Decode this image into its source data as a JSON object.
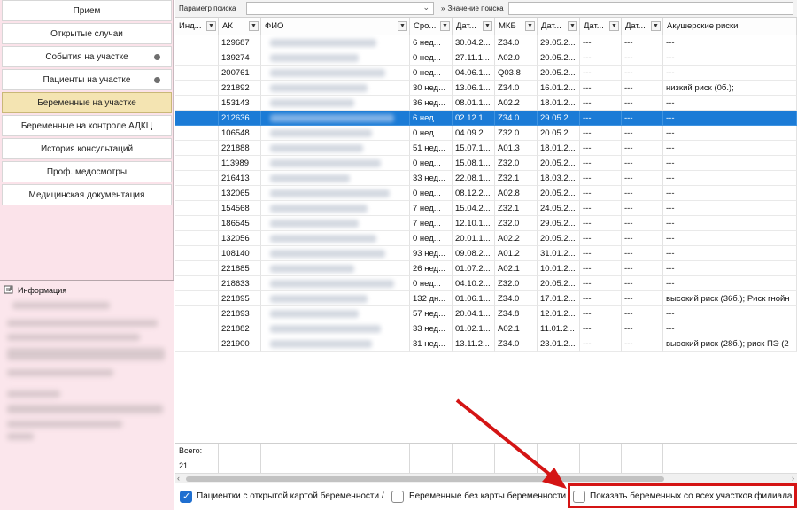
{
  "nav": {
    "items": [
      {
        "label": "Прием",
        "active": false,
        "dot": false
      },
      {
        "label": "Открытые случаи",
        "active": false,
        "dot": false
      },
      {
        "label": "События на участке",
        "active": false,
        "dot": true
      },
      {
        "label": "Пациенты на участке",
        "active": false,
        "dot": true
      },
      {
        "label": "Беременные на участке",
        "active": true,
        "dot": false
      },
      {
        "label": "Беременные на контроле АДКЦ",
        "active": false,
        "dot": false
      },
      {
        "label": "История консультаций",
        "active": false,
        "dot": false
      },
      {
        "label": "Проф. медосмотры",
        "active": false,
        "dot": false
      },
      {
        "label": "Медицинская документация",
        "active": false,
        "dot": false
      }
    ]
  },
  "info": {
    "title": "Информация"
  },
  "search": {
    "param_label": "Параметр поиска",
    "param_value": "",
    "value_label": "Значение поиска",
    "value": ""
  },
  "grid": {
    "columns": [
      {
        "label": "Инд...",
        "filter": true
      },
      {
        "label": "АК",
        "filter": true
      },
      {
        "label": "ФИО",
        "filter": true
      },
      {
        "label": "Сро...",
        "filter": true
      },
      {
        "label": "Дат...",
        "filter": true
      },
      {
        "label": "МКБ",
        "filter": true
      },
      {
        "label": "Дат...",
        "filter": true
      },
      {
        "label": "Дат...",
        "filter": true
      },
      {
        "label": "Дат...",
        "filter": true
      },
      {
        "label": "Акушерские риски",
        "filter": false
      }
    ],
    "rows": [
      {
        "ind": "",
        "ak": "129687",
        "srok": "6 нед...",
        "d1": "30.04.2...",
        "mkb": "Z34.0",
        "d2": "29.05.2...",
        "d3": "---",
        "d4": "---",
        "risk": "---"
      },
      {
        "ind": "",
        "ak": "139274",
        "srok": "0 нед...",
        "d1": "27.11.1...",
        "mkb": "A02.0",
        "d2": "20.05.2...",
        "d3": "---",
        "d4": "---",
        "risk": "---"
      },
      {
        "ind": "",
        "ak": "200761",
        "srok": "0 нед...",
        "d1": "04.06.1...",
        "mkb": "Q03.8",
        "d2": "20.05.2...",
        "d3": "---",
        "d4": "---",
        "risk": "---"
      },
      {
        "ind": "",
        "ak": "221892",
        "srok": "30 нед...",
        "d1": "13.06.1...",
        "mkb": "Z34.0",
        "d2": "16.01.2...",
        "d3": "---",
        "d4": "---",
        "risk": "низкий риск (0б.);"
      },
      {
        "ind": "",
        "ak": "153143",
        "srok": "36 нед...",
        "d1": "08.01.1...",
        "mkb": "A02.2",
        "d2": "18.01.2...",
        "d3": "---",
        "d4": "---",
        "risk": "---"
      },
      {
        "ind": "",
        "ak": "212636",
        "srok": "6 нед...",
        "d1": "02.12.1...",
        "mkb": "Z34.0",
        "d2": "29.05.2...",
        "d3": "---",
        "d4": "---",
        "risk": "---",
        "selected": true
      },
      {
        "ind": "",
        "ak": "106548",
        "srok": "0 нед...",
        "d1": "04.09.2...",
        "mkb": "Z32.0",
        "d2": "20.05.2...",
        "d3": "---",
        "d4": "---",
        "risk": "---"
      },
      {
        "ind": "",
        "ak": "221888",
        "srok": "51 нед...",
        "d1": "15.07.1...",
        "mkb": "A01.3",
        "d2": "18.01.2...",
        "d3": "---",
        "d4": "---",
        "risk": "---"
      },
      {
        "ind": "",
        "ak": "113989",
        "srok": "0 нед...",
        "d1": "15.08.1...",
        "mkb": "Z32.0",
        "d2": "20.05.2...",
        "d3": "---",
        "d4": "---",
        "risk": "---"
      },
      {
        "ind": "",
        "ak": "216413",
        "srok": "33 нед...",
        "d1": "22.08.1...",
        "mkb": "Z32.1",
        "d2": "18.03.2...",
        "d3": "---",
        "d4": "---",
        "risk": "---"
      },
      {
        "ind": "",
        "ak": "132065",
        "srok": "0 нед...",
        "d1": "08.12.2...",
        "mkb": "A02.8",
        "d2": "20.05.2...",
        "d3": "---",
        "d4": "---",
        "risk": "---"
      },
      {
        "ind": "",
        "ak": "154568",
        "srok": "7 нед...",
        "d1": "15.04.2...",
        "mkb": "Z32.1",
        "d2": "24.05.2...",
        "d3": "---",
        "d4": "---",
        "risk": "---"
      },
      {
        "ind": "",
        "ak": "186545",
        "srok": "7 нед...",
        "d1": "12.10.1...",
        "mkb": "Z32.0",
        "d2": "29.05.2...",
        "d3": "---",
        "d4": "---",
        "risk": "---"
      },
      {
        "ind": "",
        "ak": "132056",
        "srok": "0 нед...",
        "d1": "20.01.1...",
        "mkb": "A02.2",
        "d2": "20.05.2...",
        "d3": "---",
        "d4": "---",
        "risk": "---"
      },
      {
        "ind": "",
        "ak": "108140",
        "srok": "93 нед...",
        "d1": "09.08.2...",
        "mkb": "A01.2",
        "d2": "31.01.2...",
        "d3": "---",
        "d4": "---",
        "risk": "---"
      },
      {
        "ind": "",
        "ak": "221885",
        "srok": "26 нед...",
        "d1": "01.07.2...",
        "mkb": "A02.1",
        "d2": "10.01.2...",
        "d3": "---",
        "d4": "---",
        "risk": "---"
      },
      {
        "ind": "",
        "ak": "218633",
        "srok": "0 нед...",
        "d1": "04.10.2...",
        "mkb": "Z32.0",
        "d2": "20.05.2...",
        "d3": "---",
        "d4": "---",
        "risk": "---"
      },
      {
        "ind": "",
        "ak": "221895",
        "srok": "132 дн...",
        "d1": "01.06.1...",
        "mkb": "Z34.0",
        "d2": "17.01.2...",
        "d3": "---",
        "d4": "---",
        "risk": "высокий риск (36б.); Риск гнойн"
      },
      {
        "ind": "",
        "ak": "221893",
        "srok": "57 нед...",
        "d1": "20.04.1...",
        "mkb": "Z34.8",
        "d2": "12.01.2...",
        "d3": "---",
        "d4": "---",
        "risk": "---"
      },
      {
        "ind": "",
        "ak": "221882",
        "srok": "33 нед...",
        "d1": "01.02.1...",
        "mkb": "A02.1",
        "d2": "11.01.2...",
        "d3": "---",
        "d4": "---",
        "risk": "---"
      },
      {
        "ind": "",
        "ak": "221900",
        "srok": "31 нед...",
        "d1": "13.11.2...",
        "mkb": "Z34.0",
        "d2": "23.01.2...",
        "d3": "---",
        "d4": "---",
        "risk": "высокий риск (28б.); риск ПЭ (2"
      }
    ],
    "total_label": "Всего:",
    "total_count": "21"
  },
  "checkbar": {
    "open_card_label": "Пациентки с открытой картой беременности /",
    "open_card_checked": true,
    "no_card_label": "Беременные без карты беременности",
    "no_card_checked": false,
    "all_sites_label": "Показать беременных со всех участков филиала",
    "all_sites_checked": false
  },
  "colors": {
    "accent": "#1f6fd0",
    "selected_row": "#1b7bd6",
    "nav_bg": "#fbe3ea",
    "nav_active": "#f4e4b2",
    "annotation": "#d41414"
  }
}
